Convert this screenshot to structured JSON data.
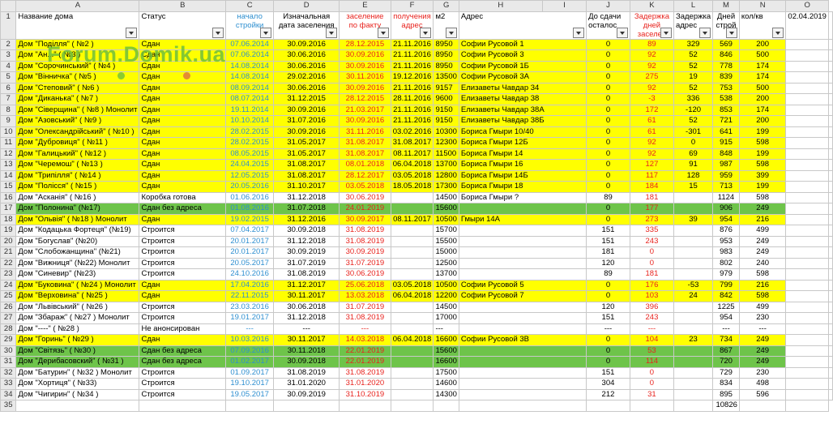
{
  "col_letters": [
    "A",
    "B",
    "C",
    "D",
    "E",
    "F",
    "G",
    "H",
    "I",
    "J",
    "K",
    "L",
    "M",
    "N",
    "O"
  ],
  "headers": {
    "A": "Название дома",
    "B": "Статус",
    "C": "начало стройки",
    "D": "Изначальная дата заселения",
    "E": "заселение по факту",
    "F": "получения адрес",
    "G": "м2",
    "H": "Адрес",
    "I": "До сдачи осталос",
    "J": "Задержка дней заселен",
    "K": "Задержка адрес",
    "L": "Дней строй",
    "M": "кол/кв",
    "N": "02.04.2019"
  },
  "header_colors": {
    "C": "#2e8fd0",
    "E": "#e8231e",
    "F": "#e8231e",
    "J": "#e8231e"
  },
  "watermark": "Forum.Domik.ua",
  "rows": [
    {
      "n": "2",
      "hl": "yellow",
      "A": "Дом \"Поділля\" ( №2 )",
      "B": "Сдан",
      "C": "07.06.2014",
      "D": "30.09.2016",
      "E": "28.12.2015",
      "F": "21.11.2016",
      "G": "8950",
      "H": "Софии Русовой 1",
      "I": "0",
      "J": "89",
      "K": "329",
      "L": "569",
      "M": "200"
    },
    {
      "n": "3",
      "hl": "yellow",
      "A": "Дом \"Ан...\" ( №3 )",
      "B": "Сдан",
      "C": "07.06.2014",
      "D": "30.06.2016",
      "E": "30.09.2016",
      "F": "21.11.2016",
      "G": "8950",
      "H": "Софии Русовой 3",
      "I": "0",
      "J": "92",
      "K": "52",
      "L": "846",
      "M": "500"
    },
    {
      "n": "4",
      "hl": "yellow",
      "A": "Дом \"Сорочинський\" ( №4 )",
      "B": "Сдан",
      "C": "14.08.2014",
      "D": "30.06.2016",
      "E": "30.09.2016",
      "F": "21.11.2016",
      "G": "8950",
      "H": "Софии Русовой 1Б",
      "I": "0",
      "J": "92",
      "K": "52",
      "L": "778",
      "M": "174"
    },
    {
      "n": "5",
      "hl": "yellow",
      "A": "Дом \"Вінничка\" ( №5 )",
      "B": "Сдан",
      "C": "14.08.2014",
      "D": "29.02.2016",
      "E": "30.11.2016",
      "F": "19.12.2016",
      "G": "13500",
      "H": "Софии Русовой 3А",
      "I": "0",
      "J": "275",
      "K": "19",
      "L": "839",
      "M": "174"
    },
    {
      "n": "6",
      "hl": "yellow",
      "A": "Дом \"Степовий\" ( №6 )",
      "B": "Сдан",
      "C": "08.09.2014",
      "D": "30.06.2016",
      "E": "30.09.2016",
      "F": "21.11.2016",
      "G": "9157",
      "H": "Елизаветы Чавдар 34",
      "I": "0",
      "J": "92",
      "K": "52",
      "L": "753",
      "M": "500"
    },
    {
      "n": "7",
      "hl": "yellow",
      "A": "Дом \"Диканька\" ( №7 )",
      "B": "Сдан",
      "C": "08.07.2014",
      "D": "31.12.2015",
      "E": "28.12.2015",
      "F": "28.11.2016",
      "G": "9600",
      "H": "Елизаветы Чавдар 38",
      "I": "0",
      "J": "-3",
      "K": "336",
      "L": "538",
      "M": "200"
    },
    {
      "n": "8",
      "hl": "yellow",
      "A": "Дом \"Сіверщина\" ( №8 ) Монолит",
      "B": "Сдан",
      "C": "19.11.2014",
      "D": "30.09.2016",
      "E": "21.03.2017",
      "F": "21.11.2016",
      "G": "9150",
      "H": "Елизаветы Чавдар 38А",
      "I": "0",
      "J": "172",
      "K": "-120",
      "L": "853",
      "M": "174"
    },
    {
      "n": "9",
      "hl": "yellow",
      "A": "Дом \"Азовський\" ( №9 )",
      "B": "Сдан",
      "C": "10.10.2014",
      "D": "31.07.2016",
      "E": "30.09.2016",
      "F": "21.11.2016",
      "G": "9150",
      "H": "Елизаветы Чавдар 38Б",
      "I": "0",
      "J": "61",
      "K": "52",
      "L": "721",
      "M": "200"
    },
    {
      "n": "10",
      "hl": "yellow",
      "A": "Дом \"Олександрійський\" ( №10 )",
      "B": "Сдан",
      "C": "28.02.2015",
      "D": "30.09.2016",
      "E": "31.11.2016",
      "F": "03.02.2016",
      "G": "10300",
      "H": "Бориса Гмыри 10/40",
      "I": "0",
      "J": "61",
      "K": "-301",
      "L": "641",
      "M": "199"
    },
    {
      "n": "11",
      "hl": "yellow",
      "A": "Дом \"Дубровиця\" ( №11 )",
      "B": "Сдан",
      "C": "28.02.2015",
      "D": "31.05.2017",
      "E": "31.08.2017",
      "F": "31.08.2017",
      "G": "12300",
      "H": "Бориса Гмыри 12Б",
      "I": "0",
      "J": "92",
      "K": "0",
      "L": "915",
      "M": "598"
    },
    {
      "n": "12",
      "hl": "yellow",
      "A": "Дом \"Галицький\" ( №12 )",
      "B": "Сдан",
      "C": "08.05.2015",
      "D": "31.05.2017",
      "E": "31.08.2017",
      "F": "08.11.2017",
      "G": "11500",
      "H": "Бориса Гмыри 14",
      "I": "0",
      "J": "92",
      "K": "69",
      "L": "848",
      "M": "199"
    },
    {
      "n": "13",
      "hl": "yellow",
      "A": "Дом \"Черемош\" ( №13 )",
      "B": "Сдан",
      "C": "24.04.2015",
      "D": "31.08.2017",
      "E": "08.01.2018",
      "F": "06.04.2018",
      "G": "13700",
      "H": "Бориса Гмыри 16",
      "I": "0",
      "J": "127",
      "K": "91",
      "L": "987",
      "M": "598"
    },
    {
      "n": "14",
      "hl": "yellow",
      "A": "Дом \"Трипілля\" ( №14 )",
      "B": "Сдан",
      "C": "12.05.2015",
      "D": "31.08.2017",
      "E": "28.12.2017",
      "F": "03.05.2018",
      "G": "12800",
      "H": "Бориса Гмыри 14Б",
      "I": "0",
      "J": "117",
      "K": "128",
      "L": "959",
      "M": "399"
    },
    {
      "n": "15",
      "hl": "yellow",
      "A": "Дом \"Полісся\" ( №15 )",
      "B": "Сдан",
      "C": "20.05.2016",
      "D": "31.10.2017",
      "E": "03.05.2018",
      "F": "18.05.2018",
      "G": "17300",
      "H": "Бориса Гмыри 18",
      "I": "0",
      "J": "184",
      "K": "15",
      "L": "713",
      "M": "199"
    },
    {
      "n": "16",
      "hl": "",
      "A": "Дом \"Асканія\" ( №16 )",
      "B": "Коробка готова",
      "C": "01.06.2016",
      "D": "31.12.2018",
      "E": "30.06.2019",
      "F": "",
      "G": "14500",
      "H": "Бориса Гмыри ?",
      "I": "89",
      "J": "181",
      "K": "",
      "L": "1124",
      "M": "598"
    },
    {
      "n": "17",
      "hl": "green",
      "A": "Дом \"Полонина\" (№17)",
      "B": "Сдан без адреса",
      "C": "01.08.2016",
      "D": "31.07.2018",
      "E": "24.01.2019",
      "F": "",
      "G": "15600",
      "H": "",
      "I": "0",
      "J": "177",
      "K": "",
      "L": "906",
      "M": "249"
    },
    {
      "n": "18",
      "hl": "yellow",
      "A": "Дом \"Ольвія\" ( №18 ) Монолит",
      "B": "Сдан",
      "C": "19.02.2015",
      "D": "31.12.2016",
      "E": "30.09.2017",
      "F": "08.11.2017",
      "G": "10500",
      "H": "Гмыри 14А",
      "I": "0",
      "J": "273",
      "K": "39",
      "L": "954",
      "M": "216"
    },
    {
      "n": "19",
      "hl": "",
      "A": "Дом \"Кодацька Фортеця\" (№19)",
      "B": "Строится",
      "C": "07.04.2017",
      "D": "30.09.2018",
      "E": "31.08.2019",
      "F": "",
      "G": "15700",
      "H": "",
      "I": "151",
      "J": "335",
      "K": "",
      "L": "876",
      "M": "499"
    },
    {
      "n": "20",
      "hl": "",
      "A": "Дом \"Богуслав\" (№20)",
      "B": "Строится",
      "C": "20.01.2017",
      "D": "31.12.2018",
      "E": "31.08.2019",
      "F": "",
      "G": "15500",
      "H": "",
      "I": "151",
      "J": "243",
      "K": "",
      "L": "953",
      "M": "249"
    },
    {
      "n": "21",
      "hl": "",
      "A": "Дом \"Слобожанщина\" (№21)",
      "B": "Строится",
      "C": "20.01.2017",
      "D": "30.09.2019",
      "E": "30.09.2019",
      "F": "",
      "G": "15000",
      "H": "",
      "I": "181",
      "J": "0",
      "K": "",
      "L": "983",
      "M": "249"
    },
    {
      "n": "22",
      "hl": "",
      "A": "Дом \"Вижниця\" (№22) Монолит",
      "B": "Строится",
      "C": "20.05.2017",
      "D": "31.07.2019",
      "E": "31.07.2019",
      "F": "",
      "G": "12500",
      "H": "",
      "I": "120",
      "J": "0",
      "K": "",
      "L": "802",
      "M": "240"
    },
    {
      "n": "23",
      "hl": "",
      "A": "Дом \"Синевир\" (№23)",
      "B": "Строится",
      "C": "24.10.2016",
      "D": "31.08.2019",
      "E": "30.06.2019",
      "F": "",
      "G": "13700",
      "H": "",
      "I": "89",
      "J": "181",
      "K": "",
      "L": "979",
      "M": "598"
    },
    {
      "n": "24",
      "hl": "yellow",
      "A": "Дом \"Буковина\" ( №24 ) Монолит",
      "B": "Сдан",
      "C": "17.04.2016",
      "D": "31.12.2017",
      "E": "25.06.2018",
      "F": "03.05.2018",
      "G": "10500",
      "H": "Софии Русовой 5",
      "I": "0",
      "J": "176",
      "K": "-53",
      "L": "799",
      "M": "216"
    },
    {
      "n": "25",
      "hl": "yellow",
      "A": "Дом \"Верховина\" ( №25 )",
      "B": "Сдан",
      "C": "22.11.2015",
      "D": "30.11.2017",
      "E": "13.03.2018",
      "F": "06.04.2018",
      "G": "12200",
      "H": "Софии Русовой 7",
      "I": "0",
      "J": "103",
      "K": "24",
      "L": "842",
      "M": "598"
    },
    {
      "n": "26",
      "hl": "",
      "A": "Дом \"Львівський\" ( №26 )",
      "B": "Строится",
      "C": "23.03.2016",
      "D": "30.06.2018",
      "E": "31.07.2019",
      "F": "",
      "G": "14500",
      "H": "",
      "I": "120",
      "J": "396",
      "K": "",
      "L": "1225",
      "M": "499"
    },
    {
      "n": "27",
      "hl": "",
      "A": "Дом \"Збараж\" ( №27 ) Монолит",
      "B": "Строится",
      "C": "19.01.2017",
      "D": "31.12.2018",
      "E": "31.08.2019",
      "F": "",
      "G": "17000",
      "H": "",
      "I": "151",
      "J": "243",
      "K": "",
      "L": "954",
      "M": "230"
    },
    {
      "n": "28",
      "hl": "",
      "A": "Дом \"----\" ( №28 )",
      "B": "Не анонсирован",
      "C": "---",
      "D": "---",
      "E": "---",
      "F": "",
      "G": "---",
      "H": "",
      "I": "---",
      "J": "---",
      "K": "",
      "L": "---",
      "M": "---"
    },
    {
      "n": "29",
      "hl": "yellow",
      "A": "Дом \"Горинь\" ( №29 )",
      "B": "Сдан",
      "C": "10.03.2016",
      "D": "30.11.2017",
      "E": "14.03.2018",
      "F": "06.04.2018",
      "G": "16600",
      "H": "Софии Русовой 3В",
      "I": "0",
      "J": "104",
      "K": "23",
      "L": "734",
      "M": "249"
    },
    {
      "n": "30",
      "hl": "green",
      "A": "Дом \"Світязь\" ( №30 )",
      "B": "Сдан без адреса",
      "C": "07.09.2016",
      "D": "30.11.2018",
      "E": "22.01.2019",
      "F": "",
      "G": "15600",
      "H": "",
      "I": "0",
      "J": "53",
      "K": "",
      "L": "867",
      "M": "249"
    },
    {
      "n": "31",
      "hl": "green",
      "A": "Дом \"Дерибасовский\" ( №31 )",
      "B": "Сдан без адреса",
      "C": "01.02.2017",
      "D": "30.09.2018",
      "E": "22.01.2019",
      "F": "",
      "G": "16600",
      "H": "",
      "I": "0",
      "J": "114",
      "K": "",
      "L": "720",
      "M": "249"
    },
    {
      "n": "32",
      "hl": "",
      "A": "Дом \"Батурин\" ( №32 ) Монолит",
      "B": "Строится",
      "C": "01.09.2017",
      "D": "31.08.2019",
      "E": "31.08.2019",
      "F": "",
      "G": "17500",
      "H": "",
      "I": "151",
      "J": "0",
      "K": "",
      "L": "729",
      "M": "230"
    },
    {
      "n": "33",
      "hl": "",
      "A": "Дом \"Хортиця\" ( №33)",
      "B": "Строится",
      "C": "19.10.2017",
      "D": "31.01.2020",
      "E": "31.01.2020",
      "F": "",
      "G": "14600",
      "H": "",
      "I": "304",
      "J": "0",
      "K": "",
      "L": "834",
      "M": "498"
    },
    {
      "n": "34",
      "hl": "",
      "A": "Дом \"Чигирин\" ( №34 )",
      "B": "Строится",
      "C": "19.05.2017",
      "D": "30.09.2019",
      "E": "31.10.2019",
      "F": "",
      "G": "14300",
      "H": "",
      "I": "212",
      "J": "31",
      "K": "",
      "L": "895",
      "M": "596"
    }
  ],
  "total_row": {
    "n": "35",
    "M": "10826"
  }
}
